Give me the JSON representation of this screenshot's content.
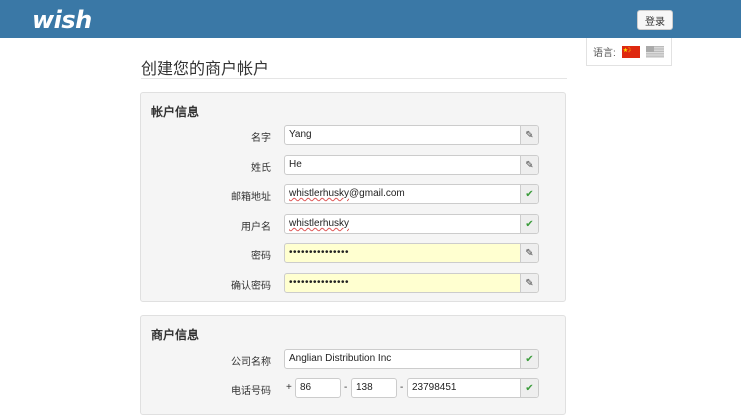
{
  "header": {
    "logo_text": "wish",
    "login_label": "登录"
  },
  "language": {
    "label": "语言:",
    "flags": [
      "china-flag",
      "us-flag"
    ]
  },
  "page": {
    "title": "创建您的商户帐户"
  },
  "account_section": {
    "title": "帐户信息",
    "fields": [
      {
        "label": "名字",
        "value": "Yang",
        "status": "edit"
      },
      {
        "label": "姓氏",
        "value": "He",
        "status": "edit"
      },
      {
        "label": "邮箱地址",
        "value_underlined": "whistlerhusky",
        "value_rest": "@gmail.com",
        "status": "ok"
      },
      {
        "label": "用户名",
        "value_underlined": "whistlerhusky",
        "status": "ok"
      },
      {
        "label": "密码",
        "value": "•••••••••••••••",
        "status": "edit"
      },
      {
        "label": "确认密码",
        "value": "•••••••••••••••",
        "status": "edit"
      }
    ]
  },
  "merchant_section": {
    "title": "商户信息",
    "company_label": "公司名称",
    "company_value": "Anglian Distribution Inc",
    "phone_label": "电话号码",
    "phone_plus": "+",
    "phone_country": "86",
    "phone_dash": "-",
    "phone_area": "138",
    "phone_number": "23798451"
  },
  "icons": {
    "edit": "✎",
    "ok": "✔"
  },
  "colors": {
    "header": "#3a78a6",
    "password_bg": "#ffffd0",
    "check": "#3c9c3c"
  }
}
